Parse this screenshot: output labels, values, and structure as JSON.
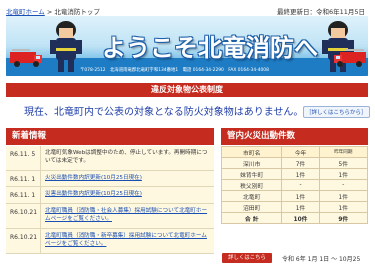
{
  "breadcrumb": {
    "home": "北竜町ホーム",
    "separator": " > ",
    "current": "北竜消防トップ"
  },
  "updated": "最終更新日：令和6年11月5日",
  "banner": {
    "title": "ようこそ北竜消防へ",
    "address": "〒078-2512　北海道雨竜郡北竜町字和134番地1　電話 0164-34-2290　FAX 0164-34-4008"
  },
  "notice": {
    "bar": "違反対象物公表制度",
    "text": "現在、北竜町内で公表の対象となる防火対象物はありません。",
    "link": "［詳しくはこちらから］"
  },
  "news": {
    "heading": "新着情報",
    "items": [
      {
        "date": "R6.11. 5",
        "text": "北竜町気象Webは調整中のため、停止しています。再開時期については未定です。",
        "link": false
      },
      {
        "date": "R6.11. 1",
        "text": "火災出動件数内訳更新(10月25日現在)",
        "link": true
      },
      {
        "date": "R6.11. 1",
        "text": "災害出動件数内訳更新(10月25日現在)",
        "link": true
      },
      {
        "date": "R6.10.21",
        "text": "北竜町職員（消防職・社会人募集）採用試験について北竜町ホームページをご覧ください。",
        "link": true
      },
      {
        "date": "R6.10.21",
        "text": "北竜町職員（消防職・新卒募集）採用試験について北竜町ホームページをご覧ください。",
        "link": true
      }
    ]
  },
  "fire": {
    "heading": "管内火災出動件数",
    "columns": [
      "市町名",
      "今年",
      "昨年同期"
    ],
    "rows": [
      {
        "name": "深川市",
        "this_year": "7件",
        "last_year": "5件"
      },
      {
        "name": "妹背牛町",
        "this_year": "1件",
        "last_year": "1件"
      },
      {
        "name": "秩父別町",
        "this_year": "-",
        "last_year": "-"
      },
      {
        "name": "北竜町",
        "this_year": "1件",
        "last_year": "1件"
      },
      {
        "name": "沼田町",
        "this_year": "1件",
        "last_year": "1件"
      }
    ],
    "total": {
      "name": "合 計",
      "this_year": "10件",
      "last_year": "9件"
    },
    "more": "詳しくはこちら",
    "period": "令和 6年 1月 1日 ～ 10月25"
  },
  "colors": {
    "accent_red": "#c62b1f",
    "link_blue": "#1a4fb3",
    "panel_cream": "#fff8e1",
    "banner_blue": "#2f9ad8"
  }
}
